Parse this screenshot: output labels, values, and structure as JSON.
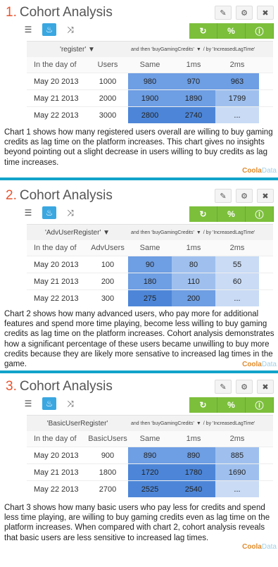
{
  "panels": [
    {
      "number": "1.",
      "title": "Cohort Analysis",
      "segment_label": "'register'",
      "then_label": "and then 'buyGamingCredits'",
      "by_label": "/ by 'IncreasedLagTime'",
      "col_day": "In the day of",
      "col_users": "Users",
      "col_same": "Same",
      "col_1ms": "1ms",
      "col_2ms": "2ms",
      "rows": [
        {
          "day": "May 20 2013",
          "users": "1000",
          "same": "980",
          "v1": "970",
          "v2": "963"
        },
        {
          "day": "May 21 2013",
          "users": "2000",
          "same": "1900",
          "v1": "1890",
          "v2": "1799"
        },
        {
          "day": "May 22 2013",
          "users": "3000",
          "same": "2800",
          "v1": "2740",
          "v2": "..."
        }
      ],
      "description": "Chart 1 shows how many registered users overall are willing to buy gaming credits as lag time on the platform increases. This chart gives no insights beyond pointing out a slight decrease in users willing to buy credits as lag time increases."
    },
    {
      "number": "2.",
      "title": "Cohort Analysis",
      "segment_label": "'AdvUserRegister'",
      "then_label": "and then 'buyGamingCredits'",
      "by_label": "/ by 'IncreasedLagTime'",
      "col_day": "In the day of",
      "col_users": "AdvUsers",
      "col_same": "Same",
      "col_1ms": "1ms",
      "col_2ms": "2ms",
      "rows": [
        {
          "day": "May 20 2013",
          "users": "100",
          "same": "90",
          "v1": "80",
          "v2": "55"
        },
        {
          "day": "May 21 2013",
          "users": "200",
          "same": "180",
          "v1": "110",
          "v2": "60"
        },
        {
          "day": "May 22 2013",
          "users": "300",
          "same": "275",
          "v1": "200",
          "v2": "..."
        }
      ],
      "description": "Chart 2 shows how many advanced users, who pay more for additional features and spend more time playing, become less willing to buy gaming credits as lag time on the platform increases. Cohort analysis demonstrates how a significant percentage of these users became unwilling to buy more credits because they are likely more sensative to increased lag times in the game."
    },
    {
      "number": "3.",
      "title": "Cohort Analysis",
      "segment_label": "'BasicUserRegister'",
      "then_label": "and then 'buyGamingCredits'",
      "by_label": "/ by 'IncreasedLagTime'",
      "col_day": "In the day of",
      "col_users": "BasicUsers",
      "col_same": "Same",
      "col_1ms": "1ms",
      "col_2ms": "2ms",
      "rows": [
        {
          "day": "May 20 2013",
          "users": "900",
          "same": "890",
          "v1": "890",
          "v2": "885"
        },
        {
          "day": "May 21 2013",
          "users": "1800",
          "same": "1720",
          "v1": "1780",
          "v2": "1690"
        },
        {
          "day": "May 22 2013",
          "users": "2700",
          "same": "2525",
          "v1": "2540",
          "v2": "..."
        }
      ],
      "description": "Chart 3 shows how many basic users who pay less for credits and spend less time playing, are willing to buy gaming credits even as lag time on the platform increases. When compared with chart 2, cohort analysis reveals that basic users are less sensitive to increased lag times."
    }
  ],
  "brand": {
    "left": "Coola",
    "right": "Data"
  },
  "icons": {
    "edit": "pencil-icon",
    "settings": "gear-icon",
    "close": "close-icon",
    "table_view": "list-icon",
    "chart_view": "flame-icon",
    "shuffle": "shuffle-icon",
    "refresh": "refresh-icon",
    "percent": "percent-icon",
    "info": "info-icon",
    "filter": "filter-icon"
  },
  "colors": {
    "title_number": "#e8542f",
    "accent_green": "#7cbf3b",
    "divider_blue": "#12a3c9",
    "cell_dark": "#4d86d8",
    "cell_light": "#c9dbf5"
  }
}
